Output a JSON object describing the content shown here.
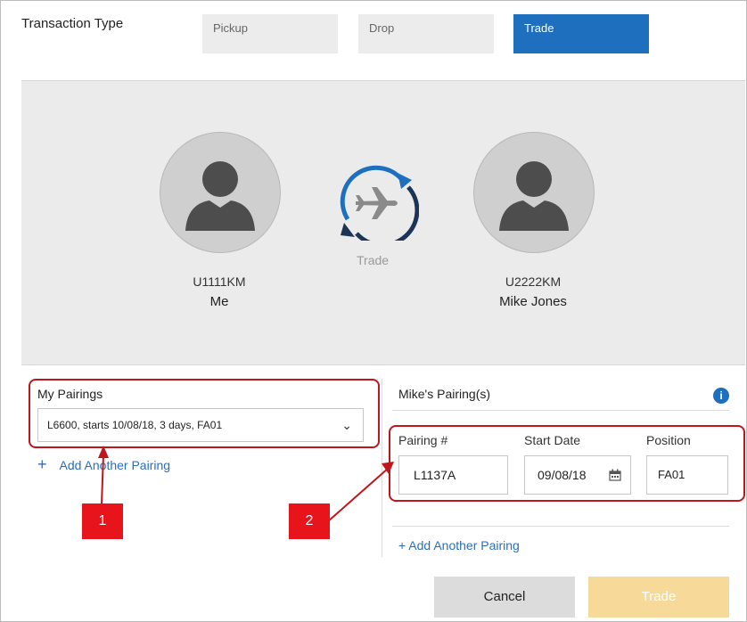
{
  "transaction_type": {
    "label": "Transaction Type",
    "options": [
      {
        "label": "Pickup",
        "selected": false
      },
      {
        "label": "Drop",
        "selected": false
      },
      {
        "label": "Trade",
        "selected": true
      }
    ]
  },
  "trade": {
    "me": {
      "id": "U1111KM",
      "name": "Me"
    },
    "other": {
      "id": "U2222KM",
      "name": "Mike Jones"
    },
    "caption": "Trade"
  },
  "my_pairings": {
    "title": "My Pairings",
    "selected": "L6600, starts 10/08/18, 3 days, FA01",
    "add_link": "Add Another Pairing"
  },
  "mikes_pairings": {
    "title": "Mike's Pairing(s)",
    "columns": [
      "Pairing #",
      "Start Date",
      "Position"
    ],
    "values": {
      "pairing": "L1137A",
      "start_date": "09/08/18",
      "position": "FA01"
    },
    "add_link": "+ Add Another Pairing"
  },
  "callouts": [
    "1",
    "2"
  ],
  "actions": {
    "cancel": "Cancel",
    "trade": "Trade"
  },
  "colors": {
    "accent": "#1f6fbf",
    "highlight": "#c0161b",
    "trade_disabled": "#f7d99a"
  },
  "icons": [
    "person-avatar-icon",
    "trade-cycle-icon",
    "airplane-icon",
    "chevron-down-icon",
    "plus-icon",
    "info-icon",
    "calendar-icon"
  ]
}
